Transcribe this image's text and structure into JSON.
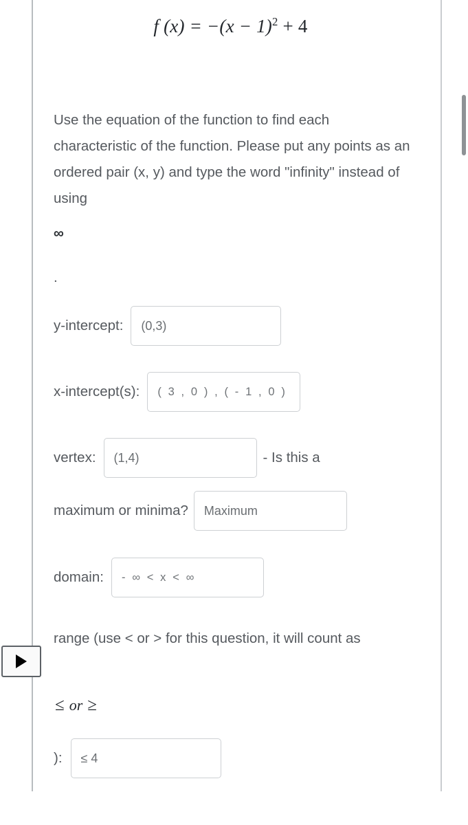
{
  "equation": {
    "lhs": "f (x) = −(x − 1)",
    "exponent": "2",
    "rhs": "+ 4",
    "plain": "f(x) = -(x - 1)^2 + 4"
  },
  "instructions": {
    "intro": "Use the equation of the function to find each characteristic of the function. Please put any points as an ordered pair (x, y) and type the word \"infinity\" instead of using",
    "infinity_symbol": "∞",
    "stray_period": ".",
    "range_note": "range (use < or > for this question, it will count as",
    "inequality_hint_le": "≤",
    "inequality_hint_or": "or",
    "inequality_hint_ge": "≥",
    "range_close_paren": "):"
  },
  "fields": {
    "y_intercept": {
      "label": "y-intercept:",
      "value": "(0,3)"
    },
    "x_intercepts": {
      "label": "x-intercept(s):",
      "value": "( 3 , 0 ) , ( - 1 , 0 )"
    },
    "vertex": {
      "label": "vertex:",
      "value": "(1,4)",
      "trailing": "- Is this a"
    },
    "max_or_min": {
      "label": "maximum or minima?",
      "value": "Maximum"
    },
    "domain": {
      "label": "domain:",
      "value": "- ∞ < x < ∞"
    },
    "range": {
      "label": "):",
      "value": "≤ 4"
    }
  },
  "controls": {
    "play_tab": "play-button",
    "scrollbar": "vertical-scrollbar"
  },
  "colors": {
    "text": "#55595e",
    "heading": "#22262b",
    "field_border": "#cdd0d3",
    "rule": "#b8bcbf",
    "scroll_thumb": "#8e9295"
  }
}
